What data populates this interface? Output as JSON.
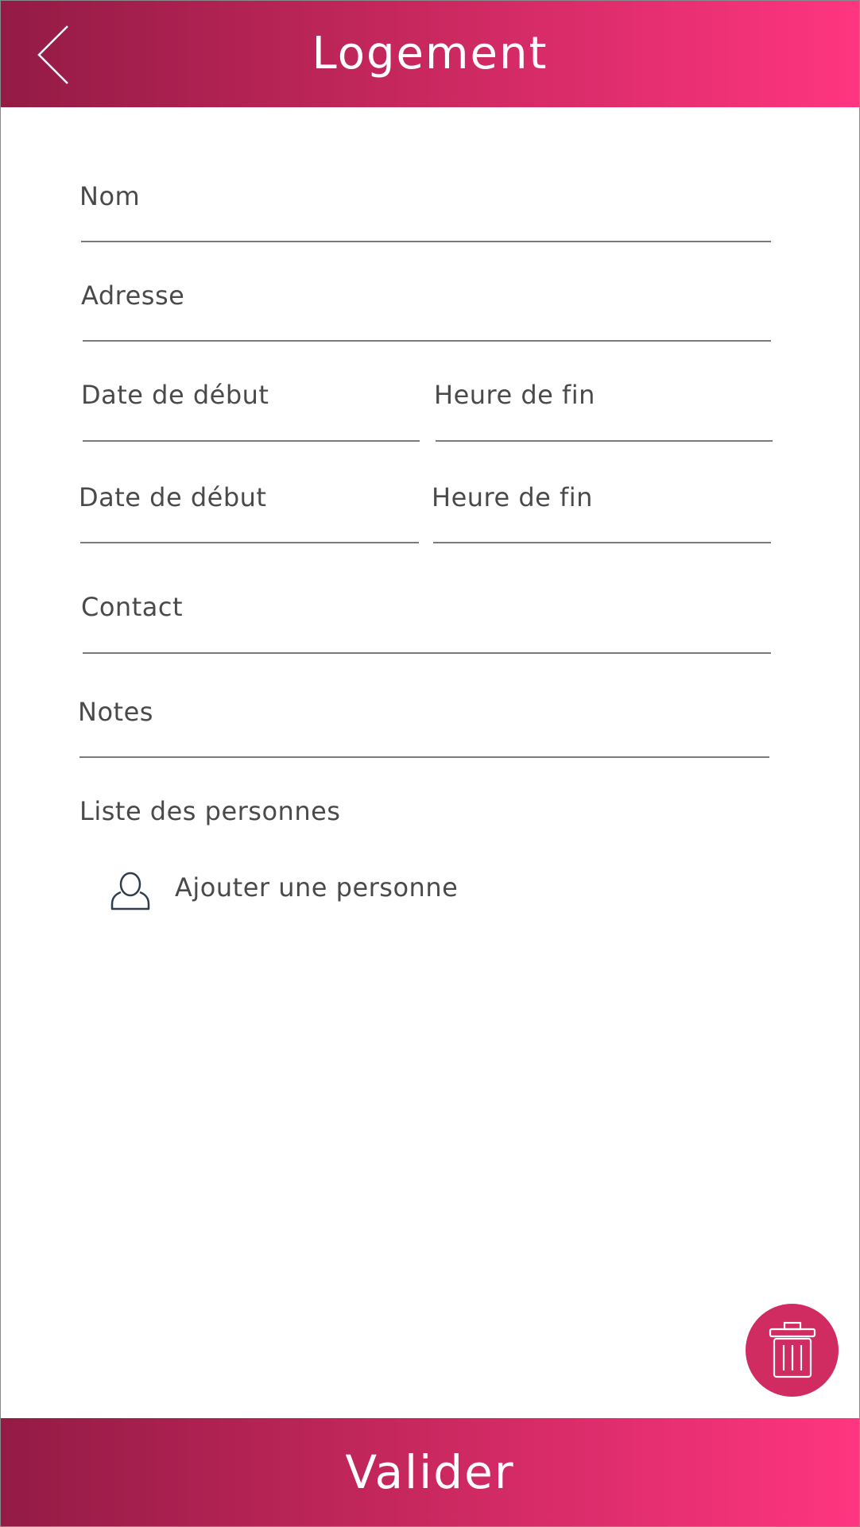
{
  "header": {
    "title": "Logement",
    "back_icon": "chevron-left-icon"
  },
  "form": {
    "nom": {
      "label": "Nom"
    },
    "adresse": {
      "label": "Adresse"
    },
    "row1": {
      "start": {
        "label": "Date de début"
      },
      "end": {
        "label": "Heure de fin"
      }
    },
    "row2": {
      "start": {
        "label": "Date de début"
      },
      "end": {
        "label": "Heure de fin"
      }
    },
    "contact": {
      "label": "Contact"
    },
    "notes": {
      "label": "Notes"
    }
  },
  "persons": {
    "section_label": "Liste des personnes",
    "add_label": "Ajouter une personne",
    "add_icon": "user-icon"
  },
  "fab": {
    "icon": "trash-icon",
    "color": "#d02c62"
  },
  "footer": {
    "submit_label": "Valider"
  },
  "colors": {
    "gradient_start": "#931b45",
    "gradient_end": "#ff3580",
    "text": "#4a4a4a",
    "line": "#7a7a7a"
  }
}
